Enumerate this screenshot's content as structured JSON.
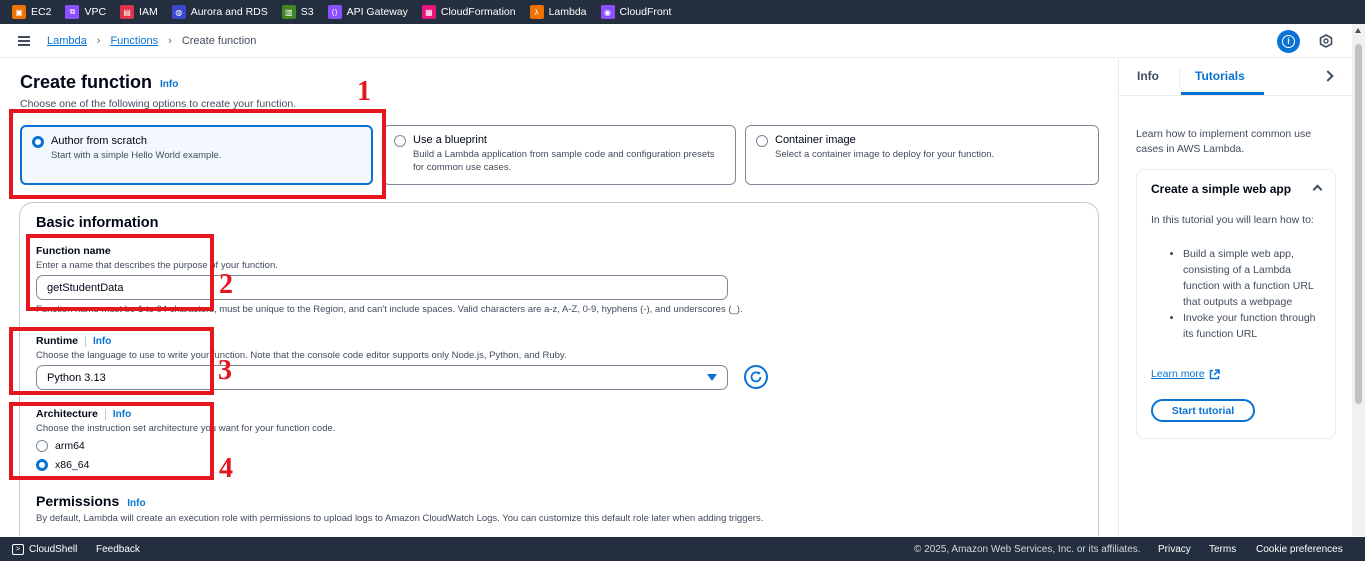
{
  "favorites": [
    {
      "label": "EC2",
      "color": "#ed7100",
      "glyph": "▣",
      "icon": "ec2-icon"
    },
    {
      "label": "VPC",
      "color": "#8c4fff",
      "glyph": "⧉",
      "icon": "vpc-icon"
    },
    {
      "label": "IAM",
      "color": "#dd344c",
      "glyph": "▤",
      "icon": "iam-icon"
    },
    {
      "label": "Aurora and RDS",
      "color": "#3b48cc",
      "glyph": "◍",
      "icon": "rds-icon"
    },
    {
      "label": "S3",
      "color": "#3f8624",
      "glyph": "▥",
      "icon": "s3-icon"
    },
    {
      "label": "API Gateway",
      "color": "#8c4fff",
      "glyph": "⟨⟩",
      "icon": "api-gateway-icon"
    },
    {
      "label": "CloudFormation",
      "color": "#e7157b",
      "glyph": "▦",
      "icon": "cloudformation-icon"
    },
    {
      "label": "Lambda",
      "color": "#ed7100",
      "glyph": "λ",
      "icon": "lambda-icon"
    },
    {
      "label": "CloudFront",
      "color": "#8c4fff",
      "glyph": "◉",
      "icon": "cloudfront-icon"
    }
  ],
  "breadcrumb": {
    "lambda": "Lambda",
    "functions": "Functions",
    "current": "Create function"
  },
  "page": {
    "title": "Create function",
    "info": "Info",
    "description": "Choose one of the following options to create your function."
  },
  "options": [
    {
      "title": "Author from scratch",
      "desc": "Start with a simple Hello World example.",
      "selected": true
    },
    {
      "title": "Use a blueprint",
      "desc": "Build a Lambda application from sample code and configuration presets for common use cases.",
      "selected": false
    },
    {
      "title": "Container image",
      "desc": "Select a container image to deploy for your function.",
      "selected": false
    }
  ],
  "basic": {
    "title": "Basic information",
    "function_name_label": "Function name",
    "function_name_desc": "Enter a name that describes the purpose of your function.",
    "function_name_value": "getStudentData",
    "function_name_constraint": "Function name must be 1 to 64 characters, must be unique to the Region, and can't include spaces. Valid characters are a-z, A-Z, 0-9, hyphens (-), and underscores (_).",
    "runtime_label": "Runtime",
    "runtime_info": "Info",
    "runtime_desc": "Choose the language to use to write your function. Note that the console code editor supports only Node.js, Python, and Ruby.",
    "runtime_value": "Python 3.13",
    "arch_label": "Architecture",
    "arch_info": "Info",
    "arch_desc": "Choose the instruction set architecture you want for your function code.",
    "arch_options": [
      {
        "label": "arm64",
        "selected": false
      },
      {
        "label": "x86_64",
        "selected": true
      }
    ],
    "permissions_title": "Permissions",
    "permissions_info": "Info",
    "permissions_desc": "By default, Lambda will create an execution role with permissions to upload logs to Amazon CloudWatch Logs. You can customize this default role later when adding triggers."
  },
  "annotations": [
    "1",
    "2",
    "3",
    "4"
  ],
  "annotation_color": "#e5161e",
  "tools": {
    "tab_info": "Info",
    "tab_tutorials": "Tutorials",
    "intro": "Learn how to implement common use cases in AWS Lambda.",
    "card_title": "Create a simple web app",
    "card_body": "In this tutorial you will learn how to:",
    "card_items": [
      "Build a simple web app, consisting of a Lambda function with a function URL that outputs a webpage",
      "Invoke your function through its function URL"
    ],
    "learn_more": "Learn more",
    "start_button": "Start tutorial"
  },
  "footer": {
    "cloudshell": "CloudShell",
    "feedback": "Feedback",
    "copyright": "© 2025, Amazon Web Services, Inc. or its affiliates.",
    "privacy": "Privacy",
    "terms": "Terms",
    "cookie": "Cookie preferences"
  },
  "accent_color": "#0972d3"
}
